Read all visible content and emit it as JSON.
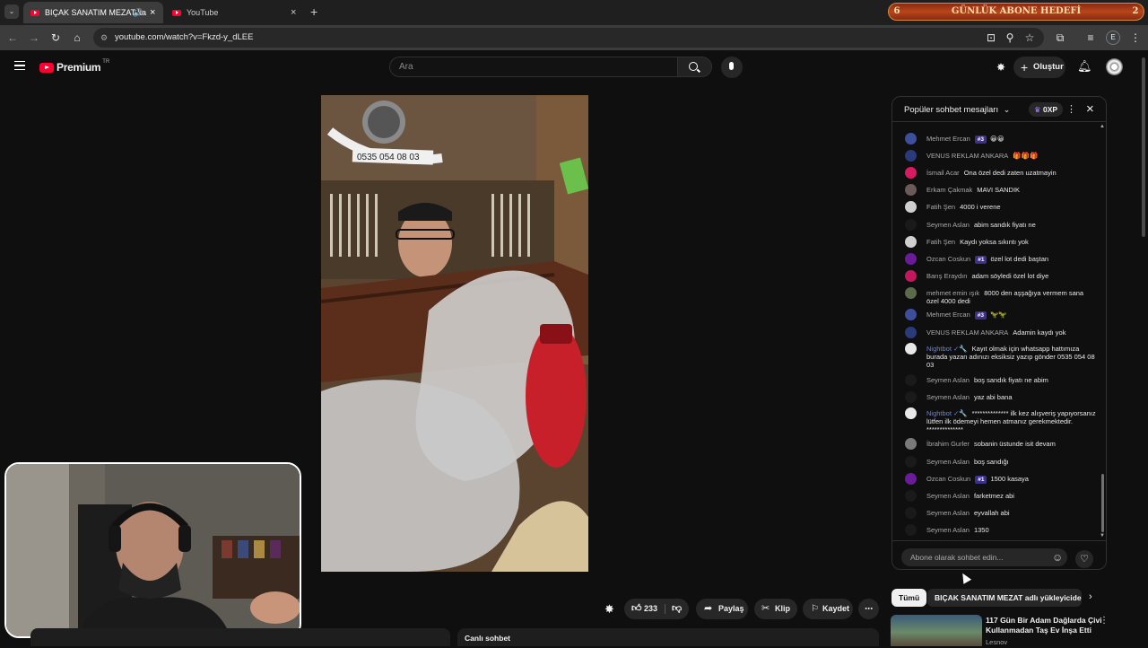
{
  "browser": {
    "tabs": [
      {
        "label": "BIÇAK SANATIM MEZAT ka"
      },
      {
        "label": "YouTube"
      }
    ],
    "url": "youtube.com/watch?v=Fkzd-y_dLEE",
    "profile_initial": "E"
  },
  "banner": {
    "text": "GÜNLÜK ABONE HEDEFİ",
    "left_number": "6",
    "right_number": "2"
  },
  "youtube": {
    "logo": "Premium",
    "logo_suffix": "TR",
    "search_placeholder": "Ara",
    "create_label": "Oluştur"
  },
  "video": {
    "phone_number": "0535 054 08 03"
  },
  "chat": {
    "title": "Popüler sohbet mesajları",
    "xp_label": "0XP",
    "input_placeholder": "Abone olarak sohbet edin...",
    "messages": [
      {
        "author": "Mehmet Ercan",
        "badge": "#3",
        "text": "😀😀",
        "color": "#3d4f9c"
      },
      {
        "author": "VENUS REKLAM ANKARA",
        "badge": "",
        "text": "🎁🎁🎁",
        "color": "#2a3a7a"
      },
      {
        "author": "İsmail Acar",
        "badge": "",
        "text": "Ona özel dedi zaten uzatmayin",
        "color": "#d81b60"
      },
      {
        "author": "Erkam Çakmak",
        "badge": "",
        "text": "MAVI SANDIK",
        "color": "#6a5a5a"
      },
      {
        "author": "Fatih Şen",
        "badge": "",
        "text": "4000 i verene",
        "color": "#cfcfcf"
      },
      {
        "author": "Seymen Aslan",
        "badge": "",
        "text": "abim sandık fiyatı ne",
        "color": "#1a1a1a"
      },
      {
        "author": "Fatih Şen",
        "badge": "",
        "text": "Kaydı yoksa sıkıntı yok",
        "color": "#cfcfcf"
      },
      {
        "author": "Ozcan Coskun",
        "badge": "#1",
        "text": "özel lot dedi baştan",
        "color": "#6a1b9a"
      },
      {
        "author": "Barış Eraydın",
        "badge": "",
        "text": "adam söyledi özel lot diye",
        "color": "#c2185b"
      },
      {
        "author": "mehmet emin ışık",
        "badge": "",
        "text": "8000 den aşşağıya vermem sana özel 4000 dedi",
        "color": "#5a6a4a"
      },
      {
        "author": "Mehmet Ercan",
        "badge": "#3",
        "text": "🦖🦖",
        "color": "#3d4f9c"
      },
      {
        "author": "VENUS REKLAM ANKARA",
        "badge": "",
        "text": "Adamin kaydı yok",
        "color": "#2a3a7a"
      },
      {
        "author": "Nightbot ✓🔧",
        "badge": "",
        "text": "Kayıt olmak için whatsapp hattımıza burada yazan adınızı eksiksiz yazıp gönder 0535 054 08 03",
        "color": "#e8e8e8",
        "mod": true
      },
      {
        "author": "Seymen Aslan",
        "badge": "",
        "text": "boş sandık fiyatı ne abim",
        "color": "#1a1a1a"
      },
      {
        "author": "Seymen Aslan",
        "badge": "",
        "text": "yaz abi bana",
        "color": "#1a1a1a"
      },
      {
        "author": "Nightbot ✓🔧",
        "badge": "",
        "text": "************** ilk kez alışveriş yapıyorsanız lütfen ilk ödemeyi hemen atmanız gerekmektedir. **************",
        "color": "#e8e8e8",
        "mod": true
      },
      {
        "author": "İbrahim Gurler",
        "badge": "",
        "text": "sobanin üstunde isit devam",
        "color": "#7a7a7a"
      },
      {
        "author": "Seymen Aslan",
        "badge": "",
        "text": "boş sandığı",
        "color": "#1a1a1a"
      },
      {
        "author": "Ozcan Coskun",
        "badge": "#1",
        "text": "1500 kasaya",
        "color": "#6a1b9a"
      },
      {
        "author": "Seymen Aslan",
        "badge": "",
        "text": "farketmez abi",
        "color": "#1a1a1a"
      },
      {
        "author": "Seymen Aslan",
        "badge": "",
        "text": "eyvallah abi",
        "color": "#1a1a1a"
      },
      {
        "author": "Seymen Aslan",
        "badge": "",
        "text": "1350",
        "color": "#1a1a1a"
      }
    ]
  },
  "actions": {
    "likes": "233",
    "share": "Paylaş",
    "clip": "Klip",
    "save": "Kaydet"
  },
  "chips": {
    "all": "Tümü",
    "channel": "BIÇAK SANATIM MEZAT adlı yükleyiciden"
  },
  "related": {
    "title": "117 Gün Bir Adam Dağlarda Çivi Kullanmadan Taş Ev İnşa Etti",
    "channel": "Lesnov"
  },
  "bottom": {
    "live_chat": "Canlı sohbet"
  }
}
